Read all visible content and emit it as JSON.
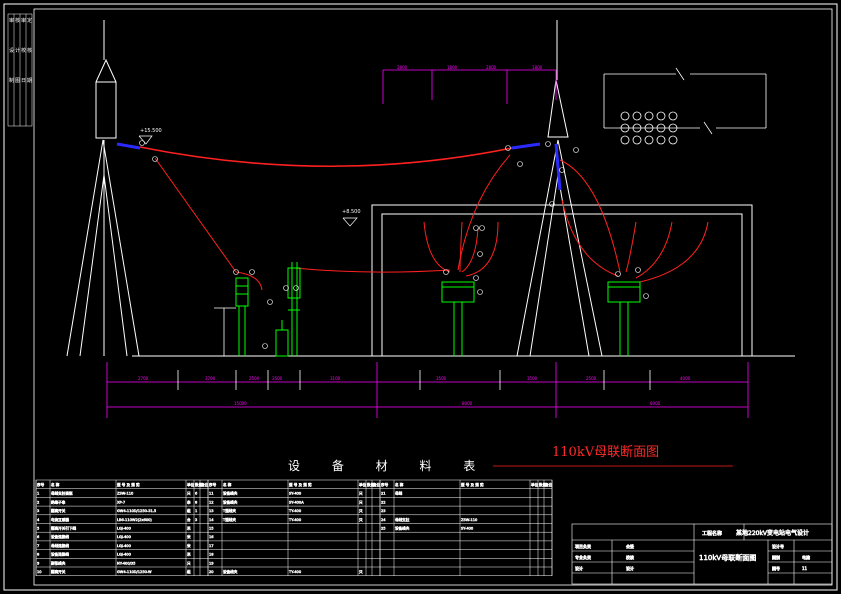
{
  "drawing": {
    "section_title": "110kV母联断面图",
    "table_title": "设 备 材 料 表"
  },
  "dimensions": {
    "top": [
      "2800",
      "1800",
      "2800",
      "1800"
    ],
    "bottom_row1": [
      "2700",
      "3700",
      "2500",
      "3500",
      "3100",
      "3500",
      "3500",
      "2500",
      "4000"
    ],
    "bottom_row2": [
      "15000",
      "8000",
      "8000"
    ],
    "elevations": [
      "+15.500",
      "+8.500"
    ]
  },
  "title_block": {
    "company": "工程名称",
    "project": "某地220kV变电站电气设计",
    "drawing_name": "110kV母联断面图",
    "rows": [
      [
        "项目负责",
        "会签"
      ],
      [
        "专业负责",
        "校核"
      ],
      [
        "设计",
        "设计"
      ]
    ],
    "right": [
      [
        "设计号",
        ""
      ],
      [
        "图别",
        "电施"
      ],
      [
        "图号",
        "11"
      ]
    ]
  },
  "materials_table": {
    "headers": [
      "序号",
      "名 称",
      "型 号 及 规 范",
      "单位",
      "数量",
      "备注"
    ],
    "left_rows": [
      [
        "1",
        "母线支柱瓷瓶",
        "ZSW-110",
        "只",
        "6",
        ""
      ],
      [
        "2",
        "绝缘子串",
        "XP-7",
        "串",
        "8",
        ""
      ],
      [
        "3",
        "隔离开关",
        "GW4-110D/1250-31.5",
        "组",
        "1",
        ""
      ],
      [
        "4",
        "电流互感器",
        "LB6-110W2(2x600)",
        "台",
        "3",
        ""
      ],
      [
        "5",
        "隔离开关引下线",
        "LGJ-400",
        "米",
        "",
        ""
      ],
      [
        "6",
        "设备连接线",
        "LGJ-400",
        "米",
        "",
        ""
      ],
      [
        "7",
        "母线连接线",
        "LGJ-400",
        "米",
        "",
        ""
      ],
      [
        "8",
        "设备连接线",
        "LGJ-400",
        "米",
        "",
        ""
      ],
      [
        "9",
        "耐张线夹",
        "NY-400/35",
        "只",
        "",
        ""
      ],
      [
        "10",
        "隔离开关",
        "GW4-110D/1250-W",
        "组",
        "",
        ""
      ]
    ],
    "mid_rows": [
      [
        "11",
        "设备线夹",
        "SY-400",
        "只",
        "",
        ""
      ],
      [
        "12",
        "设备线夹",
        "SY-400A",
        "只",
        "",
        ""
      ],
      [
        "13",
        "T型线夹",
        "TY-400",
        "只",
        "",
        ""
      ],
      [
        "14",
        "T型线夹",
        "TY-400",
        "只",
        "",
        ""
      ],
      [
        "15",
        "",
        "",
        "",
        "",
        ""
      ],
      [
        "16",
        "",
        "",
        "",
        "",
        ""
      ],
      [
        "17",
        "",
        "",
        "",
        "",
        ""
      ],
      [
        "18",
        "",
        "",
        "",
        "",
        ""
      ],
      [
        "19",
        "",
        "",
        "",
        "",
        ""
      ],
      [
        "20",
        "设备线夹",
        "TY-400",
        "只",
        "",
        ""
      ]
    ],
    "right_rows": [
      [
        "21",
        "母线",
        "",
        "",
        "",
        ""
      ],
      [
        "22",
        "",
        "",
        "",
        "",
        ""
      ],
      [
        "23",
        "",
        "",
        "",
        "",
        ""
      ],
      [
        "24",
        "母线支柱",
        "ZSW-110",
        "",
        "",
        ""
      ],
      [
        "25",
        "设备线夹",
        "SY-400",
        "",
        "",
        ""
      ]
    ]
  },
  "left_strip": [
    "审",
    "核",
    "审",
    "定",
    "设",
    "计",
    "校",
    "核",
    "制",
    "图",
    "日",
    "期"
  ],
  "colors": {
    "background": "#000000",
    "structure": "#ffffff",
    "conductor": "#ff2020",
    "equipment": "#00ff00",
    "dimension": "#ff00ff",
    "insulator": "#2a2aff",
    "label": "#ffffff"
  }
}
